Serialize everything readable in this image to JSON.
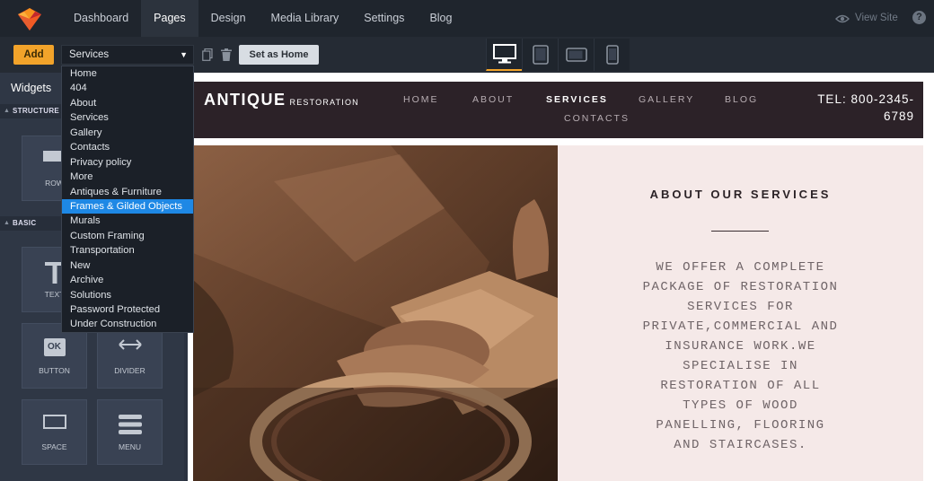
{
  "topbar": {
    "nav": [
      {
        "label": "Dashboard",
        "active": false
      },
      {
        "label": "Pages",
        "active": true
      },
      {
        "label": "Design",
        "active": false
      },
      {
        "label": "Media Library",
        "active": false
      },
      {
        "label": "Settings",
        "active": false
      },
      {
        "label": "Blog",
        "active": false
      }
    ],
    "view_site": "View Site",
    "help": "?"
  },
  "toolbar": {
    "add_label": "Add",
    "selected_page": "Services",
    "set_home_label": "Set as Home",
    "devices": [
      "desktop",
      "tablet",
      "tablet-landscape",
      "mobile"
    ],
    "active_device": "desktop"
  },
  "page_dropdown": {
    "options": [
      "Home",
      "404",
      "About",
      "Services",
      "Gallery",
      "Contacts",
      "Privacy policy",
      "More",
      "Antiques & Furniture",
      "Frames & Gilded Objects",
      "Murals",
      "Custom Framing",
      "Transportation",
      "New",
      "Archive",
      "Solutions",
      "Password Protected",
      "Under Construction"
    ],
    "highlighted": "Frames & Gilded Objects"
  },
  "sidebar": {
    "title": "Widgets",
    "sections": [
      {
        "label": "STRUCTURE"
      },
      {
        "label": "BASIC"
      }
    ],
    "tiles": [
      {
        "label": "ROW",
        "icon": "row-icon"
      },
      {
        "label": "TEXT",
        "icon": "text-icon"
      },
      {
        "label": "BUTTON",
        "icon": "button-icon",
        "icon_text": "OK"
      },
      {
        "label": "DIVIDER",
        "icon": "divider-icon"
      },
      {
        "label": "SPACE",
        "icon": "space-icon"
      },
      {
        "label": "MENU",
        "icon": "menu-icon"
      }
    ]
  },
  "site": {
    "brand": "ANTIQUE",
    "brand_sub": "RESTORATION",
    "nav": [
      {
        "label": "HOME",
        "active": false
      },
      {
        "label": "ABOUT",
        "active": false
      },
      {
        "label": "SERVICES",
        "active": true
      },
      {
        "label": "GALLERY",
        "active": false
      },
      {
        "label": "BLOG",
        "active": false
      },
      {
        "label": "CONTACTS",
        "active": false
      }
    ],
    "phone": "TEL: 800-2345-6789",
    "about_title": "ABOUT OUR SERVICES",
    "about_text": "WE OFFER A COMPLETE PACKAGE OF RESTORATION SERVICES FOR PRIVATE,COMMERCIAL AND INSURANCE WORK.WE SPECIALISE IN RESTORATION OF ALL TYPES OF WOOD PANELLING, FLOORING AND STAIRCASES."
  },
  "colors": {
    "accent": "#f2a32a",
    "highlight": "#1e88e5",
    "site_header": "#2c2228",
    "about_bg": "#f5e9e8"
  }
}
